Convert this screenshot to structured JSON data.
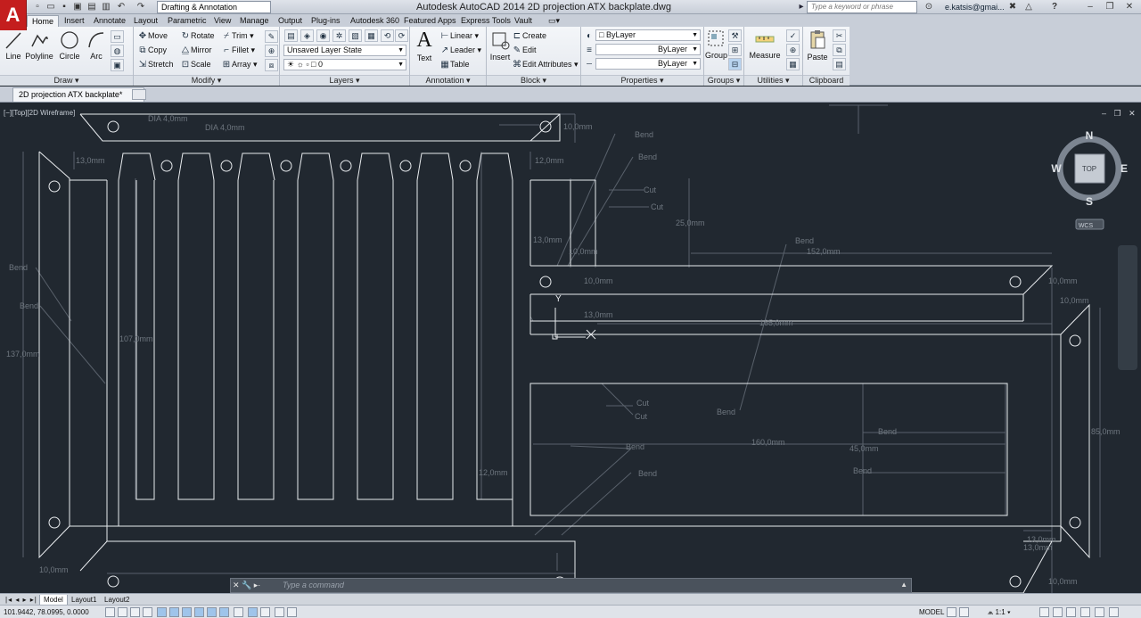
{
  "titlebar": {
    "app_logo": "A",
    "workspace": "Drafting & Annotation",
    "window_title": "Autodesk AutoCAD 2014    2D projection ATX backplate.dwg",
    "search_placeholder": "Type a keyword or phrase",
    "user": "e.katsis@gmai...",
    "help": "?",
    "minimize": "–",
    "restore": "❐",
    "close": "✕"
  },
  "ribbon_tabs": [
    "Home",
    "Insert",
    "Annotate",
    "Layout",
    "Parametric",
    "View",
    "Manage",
    "Output",
    "Plug-ins",
    "Autodesk 360",
    "Featured Apps",
    "Express Tools",
    "Vault"
  ],
  "ribbon": {
    "draw": {
      "title": "Draw",
      "line": "Line",
      "polyline": "Polyline",
      "circle": "Circle",
      "arc": "Arc"
    },
    "modify": {
      "title": "Modify",
      "move": "Move",
      "rotate": "Rotate",
      "trim": "Trim",
      "copy": "Copy",
      "mirror": "Mirror",
      "fillet": "Fillet",
      "stretch": "Stretch",
      "scale": "Scale",
      "array": "Array"
    },
    "layers": {
      "title": "Layers",
      "layer_state": "Unsaved Layer State",
      "current_layer": "0"
    },
    "annotation": {
      "title": "Annotation",
      "text": "Text",
      "linear": "Linear",
      "leader": "Leader",
      "table": "Table"
    },
    "block": {
      "title": "Block",
      "insert": "Insert",
      "create": "Create",
      "edit": "Edit",
      "edit_attributes": "Edit Attributes"
    },
    "properties": {
      "title": "Properties",
      "color": "ByLayer",
      "lineweight": "ByLayer",
      "linetype": "ByLayer"
    },
    "groups": {
      "title": "Groups",
      "group": "Group"
    },
    "utilities": {
      "title": "Utilities",
      "measure": "Measure"
    },
    "clipboard": {
      "title": "Clipboard",
      "paste": "Paste"
    }
  },
  "file_tab": {
    "name": "2D projection ATX backplate*",
    "close": "✕"
  },
  "viewport": {
    "label": "[−][Top][2D Wireframe]",
    "compass": {
      "n": "N",
      "s": "S",
      "e": "E",
      "w": "W",
      "top": "TOP",
      "wcs": "WCS"
    },
    "ucs_y": "Y",
    "dims": [
      "DIA 4,0mm",
      "DIA 4,0mm",
      "13,0mm",
      "12,0mm",
      "10,0mm",
      "Bend",
      "Bend",
      "Cut",
      "Cut",
      "25,0mm",
      "13,0mm",
      "10,0mm",
      "152,0mm",
      "Bend",
      "10,0mm",
      "10,0mm",
      "13,0mm",
      "165,0mm",
      "Bend",
      "Bend",
      "137,0mm",
      "107,0mm",
      "Cut",
      "Cut",
      "Bend",
      "160,0mm",
      "Bend",
      "45,0mm",
      "Bend",
      "Bend",
      "85,0mm",
      "12,0mm",
      "13,0mm",
      "13,0mm",
      "10,0mm",
      "10,0mm",
      "Bend",
      "10,0mm"
    ]
  },
  "command_line": {
    "placeholder": "Type a command"
  },
  "layout_tabs": [
    "Model",
    "Layout1",
    "Layout2"
  ],
  "status": {
    "coords": "101.9442, 78.0995, 0.0000",
    "space": "MODEL",
    "scale": "1:1"
  }
}
